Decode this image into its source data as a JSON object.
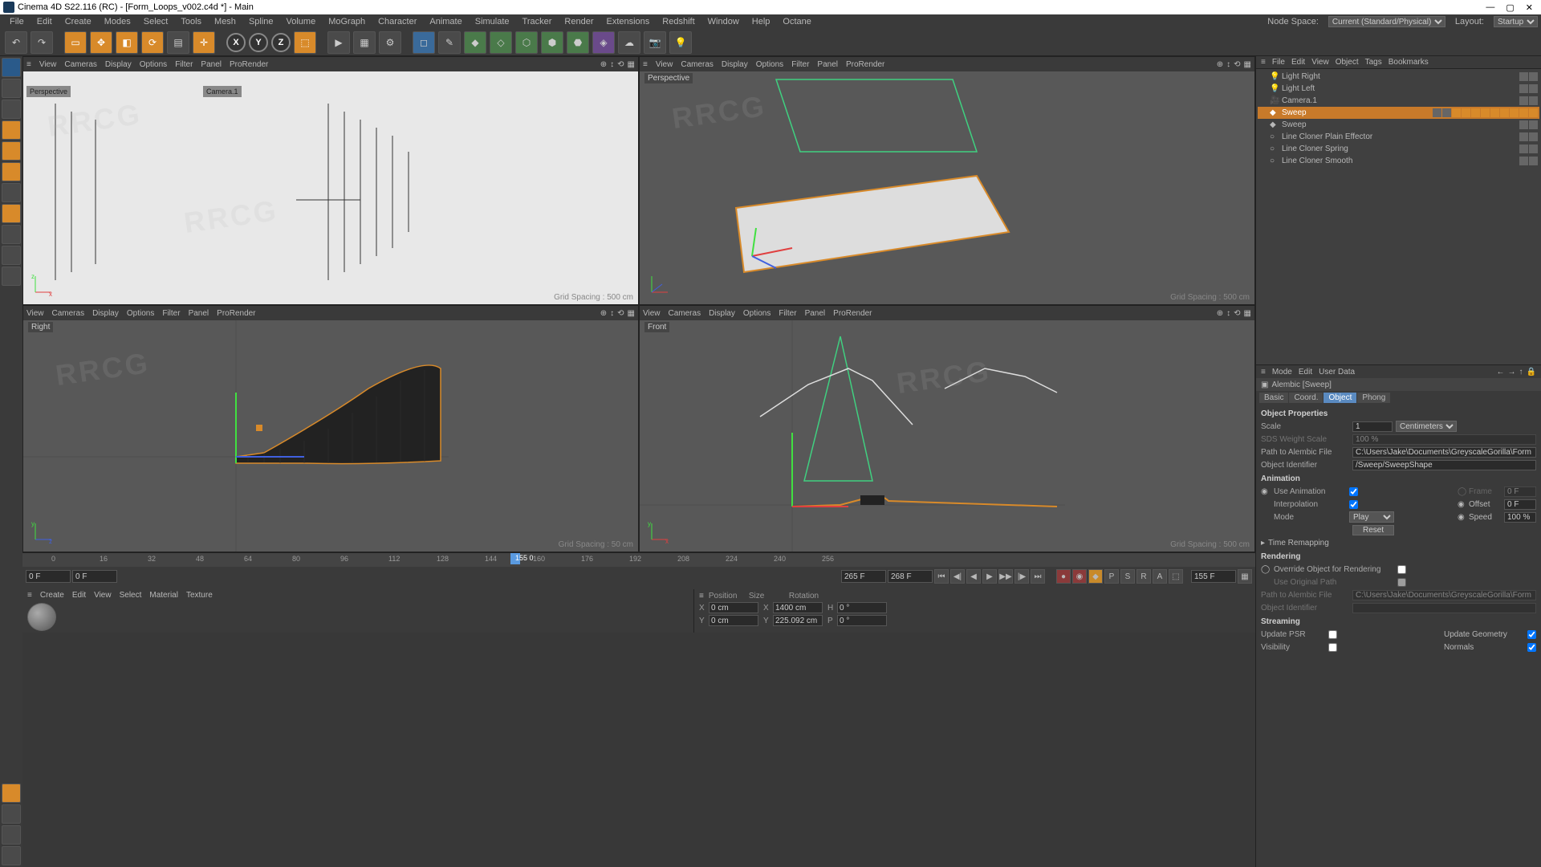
{
  "title": "Cinema 4D S22.116 (RC) - [Form_Loops_v002.c4d *] - Main",
  "menubar": [
    "File",
    "Edit",
    "Create",
    "Modes",
    "Select",
    "Tools",
    "Mesh",
    "Spline",
    "Volume",
    "MoGraph",
    "Character",
    "Animate",
    "Simulate",
    "Tracker",
    "Render",
    "Extensions",
    "Redshift",
    "Window",
    "Help",
    "Octane"
  ],
  "menubar_right": {
    "node_space_label": "Node Space:",
    "node_space": "Current (Standard/Physical)",
    "layout_label": "Layout:",
    "layout": "Startup"
  },
  "axes": {
    "x": "X",
    "y": "Y",
    "z": "Z"
  },
  "viewports": {
    "vp_menu": [
      "View",
      "Cameras",
      "Display",
      "Options",
      "Filter",
      "Panel",
      "ProRender"
    ],
    "tl": {
      "label": "Perspective",
      "tab": "Camera.1",
      "grid": "Grid Spacing : 500 cm"
    },
    "tr": {
      "label": "Perspective",
      "grid": "Grid Spacing : 500 cm"
    },
    "bl": {
      "label": "Right",
      "grid": "Grid Spacing : 50 cm"
    },
    "br": {
      "label": "Front",
      "grid": "Grid Spacing : 500 cm"
    }
  },
  "timeline": {
    "ticks": [
      "0",
      "16",
      "32",
      "48",
      "64",
      "80",
      "96",
      "112",
      "128",
      "144",
      "160",
      "176",
      "192",
      "208",
      "224",
      "240",
      "256"
    ],
    "current": "155 0",
    "start": "0 F",
    "startB": "0 F",
    "endA": "265 F",
    "endB": "268 F",
    "end_right": "155 F"
  },
  "materials_menu": [
    "Create",
    "Edit",
    "View",
    "Select",
    "Material",
    "Texture"
  ],
  "coord": {
    "headers": {
      "pos": "Position",
      "size": "Size",
      "rot": "Rotation"
    },
    "x": {
      "p": "0 cm",
      "s": "1400 cm",
      "r": "0 °"
    },
    "y": {
      "p": "0 cm",
      "s": "225.092 cm",
      "r": "0 °"
    }
  },
  "om": {
    "menu": [
      "File",
      "Edit",
      "View",
      "Object",
      "Tags",
      "Bookmarks"
    ],
    "items": [
      {
        "name": "Light Right",
        "icon": "light"
      },
      {
        "name": "Light Left",
        "icon": "light"
      },
      {
        "name": "Camera.1",
        "icon": "camera"
      },
      {
        "name": "Sweep",
        "icon": "sweep",
        "sel": true,
        "many_tags": true
      },
      {
        "name": "Sweep",
        "icon": "sweep"
      },
      {
        "name": "Line Cloner Plain Effector",
        "icon": "null"
      },
      {
        "name": "Line Cloner Spring",
        "icon": "null"
      },
      {
        "name": "Line Cloner Smooth",
        "icon": "null"
      }
    ]
  },
  "attr": {
    "menu": [
      "Mode",
      "Edit",
      "User Data"
    ],
    "title": "Alembic [Sweep]",
    "tabs": [
      "Basic",
      "Coord.",
      "Object",
      "Phong"
    ],
    "active_tab": "Object",
    "object_properties": "Object Properties",
    "scale_label": "Scale",
    "scale_val": "1",
    "scale_unit": "Centimeters",
    "sds_label": "SDS Weight Scale",
    "sds_val": "100 %",
    "path_label": "Path to Alembic File",
    "path_val": "C:\\Users\\Jake\\Documents\\GreyscaleGorilla\\Form Loops\\alem",
    "ident_label": "Object Identifier",
    "ident_val": "/Sweep/SweepShape",
    "animation": "Animation",
    "use_anim": "Use Animation",
    "frame": "Frame",
    "frame_val": "0 F",
    "interp": "Interpolation",
    "offset": "Offset",
    "offset_val": "0 F",
    "mode": "Mode",
    "mode_val": "Play",
    "speed": "Speed",
    "speed_val": "100 %",
    "reset": "Reset",
    "time_remap": "Time Remapping",
    "rendering": "Rendering",
    "override": "Override Object for Rendering",
    "use_orig": "Use Original Path",
    "path2_label": "Path to Alembic File",
    "path2_val": "C:\\Users\\Jake\\Documents\\GreyscaleGorilla\\Form Loops\\alem",
    "ident2_label": "Object Identifier",
    "streaming": "Streaming",
    "upd_psr": "Update PSR",
    "upd_geom": "Update Geometry",
    "visibility": "Visibility",
    "normals": "Normals"
  },
  "watermark": "RRCG"
}
